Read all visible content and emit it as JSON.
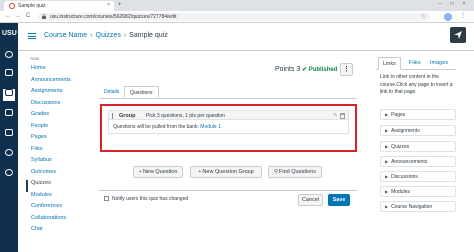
{
  "browser": {
    "tab_title": "Sample quiz",
    "tab_close": "×",
    "new_tab": "+",
    "back": "←",
    "forward": "→",
    "reload": "C",
    "url": "usu.instructure.com/courses/562682/quizzes/727784/edit",
    "star": "☆",
    "menu": "⋮",
    "win_min": "–",
    "win_max": "□",
    "win_close": "×"
  },
  "global_nav": {
    "logo": "USU"
  },
  "header": {
    "breadcrumbs": [
      "Course Name",
      "Quizzes",
      "Sample quiz"
    ],
    "separator": "›"
  },
  "course_nav": {
    "toggle_label": "Auto",
    "items": [
      {
        "label": "Home"
      },
      {
        "label": "Announcements"
      },
      {
        "label": "Assignments"
      },
      {
        "label": "Discussions"
      },
      {
        "label": "Grades"
      },
      {
        "label": "People"
      },
      {
        "label": "Pages"
      },
      {
        "label": "Files"
      },
      {
        "label": "Syllabus"
      },
      {
        "label": "Outcomes"
      },
      {
        "label": "Quizzes"
      },
      {
        "label": "Modules"
      },
      {
        "label": "Conferences"
      },
      {
        "label": "Collaborations"
      },
      {
        "label": "Chat"
      }
    ],
    "active": "Quizzes"
  },
  "quiz": {
    "points_label": "Points",
    "points_value": "3",
    "status_icon": "✔",
    "status": "Published",
    "more_label": "⋮",
    "tabs": [
      "Details",
      "Questions"
    ],
    "group": {
      "label": "Group",
      "pick_text": "Pick 3 questions, 1 pts per question",
      "bank_prefix": "Questions will be pulled from the bank:",
      "bank_name": "Module 1"
    },
    "actions": {
      "new_question": "New Question",
      "new_group": "New Question Group",
      "find_questions": "Find Questions"
    },
    "notify_label": "Notify users this quiz has changed",
    "cancel": "Cancel",
    "save": "Save"
  },
  "sidebar": {
    "tabs": [
      "Links",
      "Files",
      "Images"
    ],
    "help": "Link to other content in the course.Click any page to insert a link to that page.",
    "items": [
      {
        "label": "Pages"
      },
      {
        "label": "Assignments"
      },
      {
        "label": "Quizzes"
      },
      {
        "label": "Announcements"
      },
      {
        "label": "Discussions"
      },
      {
        "label": "Modules"
      },
      {
        "label": "Course Navigation"
      }
    ]
  },
  "colors": {
    "brand_nav": "#0e2f4d",
    "link": "#0374b5",
    "published": "#0b874b",
    "highlight": "#d8232a"
  }
}
